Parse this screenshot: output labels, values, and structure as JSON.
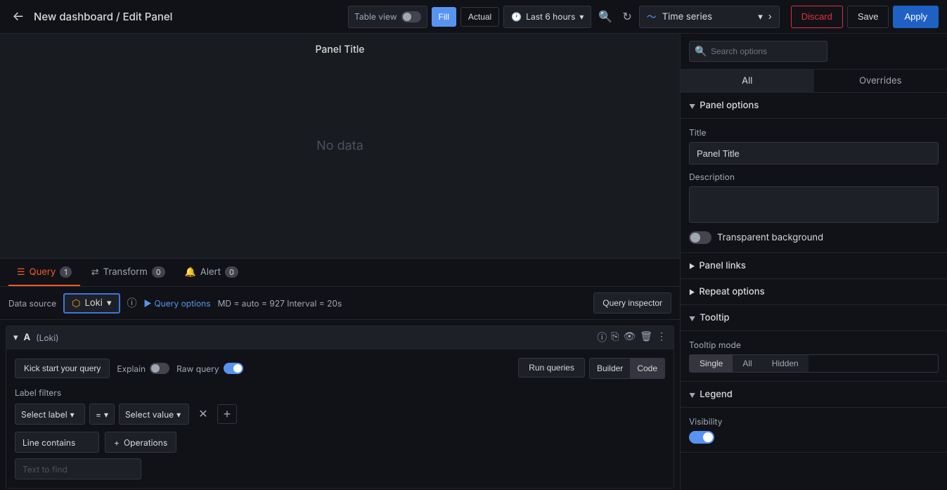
{
  "header": {
    "back_icon": "←",
    "title": "New dashboard / Edit Panel",
    "toolbar": {
      "table_view_label": "Table view",
      "fill_label": "Fill",
      "actual_label": "Actual",
      "time_icon": "🕐",
      "time_label": "Last 6 hours",
      "refresh_icon": "↻",
      "zoom_icon": "🔍"
    },
    "timeseries_icon": "〜",
    "timeseries_label": "Time series",
    "btn_discard": "Discard",
    "btn_save": "Save",
    "btn_apply": "Apply"
  },
  "viz": {
    "panel_title": "Panel Title",
    "no_data": "No data"
  },
  "query_tabs": [
    {
      "id": "query",
      "icon": "☰",
      "label": "Query",
      "badge": "1",
      "active": true
    },
    {
      "id": "transform",
      "icon": "⇄",
      "label": "Transform",
      "badge": "0",
      "active": false
    },
    {
      "id": "alert",
      "icon": "🔔",
      "label": "Alert",
      "badge": "0",
      "active": false
    }
  ],
  "query_bar": {
    "datasource_label": "Data source",
    "datasource_name": "Loki",
    "datasource_icon": "⬡",
    "info_icon": "ⓘ",
    "query_options_label": "Query options",
    "query_options_icon": "▶",
    "query_meta": "MD = auto = 927   Interval = 20s",
    "inspector_label": "Query inspector"
  },
  "query_row": {
    "letter": "A",
    "source": "(Loki)",
    "icons": [
      "ⓘ",
      "⎘",
      "👁",
      "🗑",
      "⋮"
    ],
    "kickstart_label": "Kick start your query",
    "explain_label": "Explain",
    "raw_query_label": "Raw query",
    "run_queries_label": "Run queries",
    "builder_label": "Builder",
    "code_label": "Code",
    "label_filters_title": "Label filters",
    "select_label": "Select label",
    "operator": "=",
    "select_value": "Select value",
    "line_contains_label": "Line contains",
    "operations_label": "Operations",
    "operations_icon": "+",
    "text_to_find_placeholder": "Text to find"
  },
  "right_panel": {
    "search_placeholder": "Search options",
    "tabs": [
      {
        "label": "All",
        "active": true
      },
      {
        "label": "Overrides",
        "active": false
      }
    ],
    "panel_options": {
      "title_label": "Panel options",
      "title_field_label": "Title",
      "title_value": "Panel Title",
      "desc_label": "Description",
      "desc_value": "",
      "transparent_label": "Transparent background"
    },
    "panel_links": {
      "label": "Panel links"
    },
    "repeat_options": {
      "label": "Repeat options"
    },
    "tooltip": {
      "label": "Tooltip",
      "mode_label": "Tooltip mode",
      "modes": [
        "Single",
        "All",
        "Hidden"
      ],
      "active_mode": "Single"
    },
    "legend": {
      "label": "Legend",
      "visibility_label": "Visibility"
    }
  }
}
